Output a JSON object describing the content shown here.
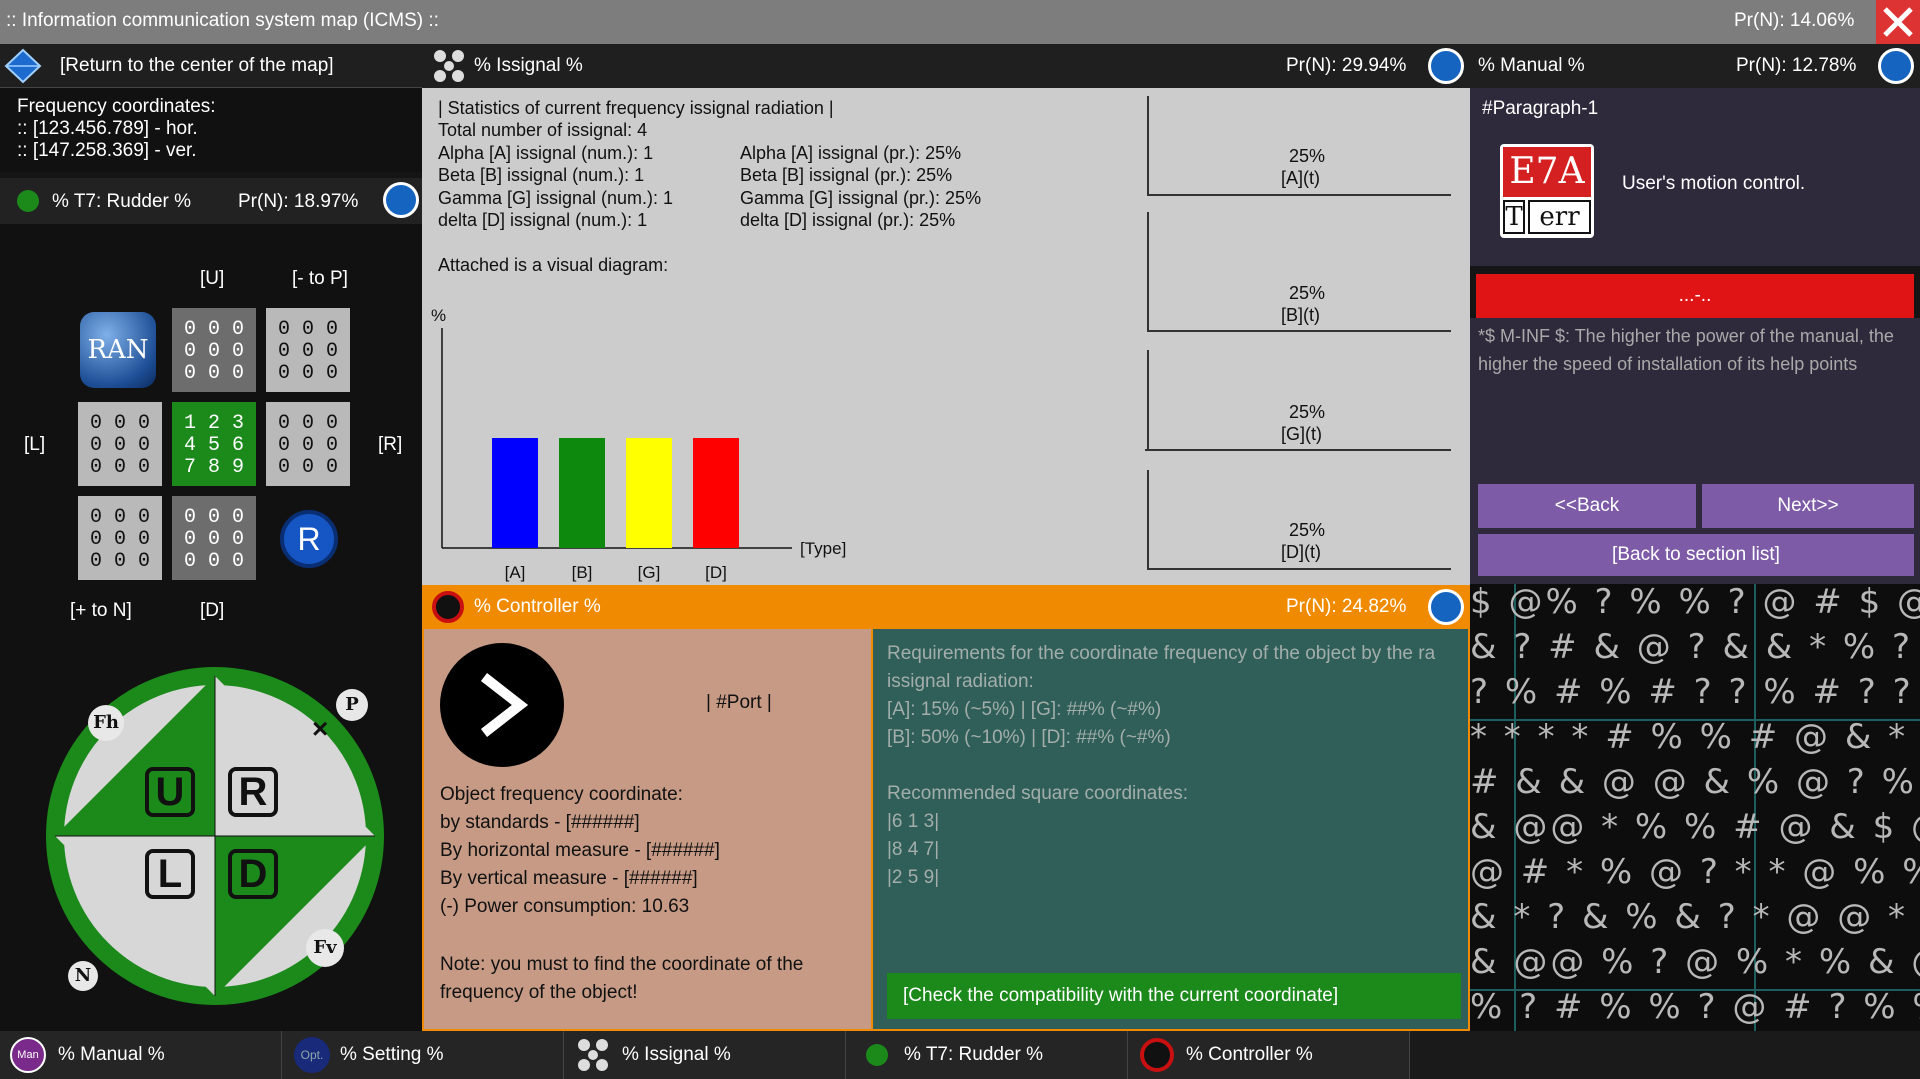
{
  "title": {
    "text": ":: Information communication system map (ICMS) ::",
    "pr": "Pr(N): 14.06%"
  },
  "map": {
    "return_label": "[Return to the center of the map]",
    "freq_title": "Frequency coordinates:",
    "hor": ":: [123.456.789] - hor.",
    "ver": ":: [147.258.369] - ver."
  },
  "rudder": {
    "title": "% T7: Rudder %",
    "pr": "Pr(N): 18.97%",
    "labels": {
      "u": "[U]",
      "to_p": "[- to P]",
      "l": "[L]",
      "r": "[R]",
      "to_n": "[+ to N]",
      "d": "[D]"
    },
    "ran": "RAN",
    "reg": "R",
    "cells": {
      "empty": "0 0 0\n0 0 0\n0 0 0",
      "center": "1 2 3\n4 5 6\n7 8 9"
    },
    "compass": {
      "u": "U",
      "r": "R",
      "l": "L",
      "d": "D",
      "fh": "Fh",
      "p": "P",
      "n": "N",
      "fv": "Fv",
      "x": "×"
    }
  },
  "issignal": {
    "title": "% Issignal %",
    "pr": "Pr(N): 29.94%",
    "heading": "| Statistics of current frequency issignal radiation |",
    "total": "Total number of issignal: 4",
    "rows": [
      {
        "name": "Alpha [A] issignal (num.): 1",
        "pr": "Alpha [A] issignal (pr.): 25%"
      },
      {
        "name": "Beta [B] issignal (num.): 1",
        "pr": "Beta [B] issignal (pr.): 25%"
      },
      {
        "name": "Gamma [G] issignal (num.): 1",
        "pr": "Gamma [G] issignal (pr.): 25%"
      },
      {
        "name": "delta [D] issignal (num.): 1",
        "pr": "delta [D] issignal (pr.): 25%"
      }
    ],
    "attached": "Attached is a visual diagram:"
  },
  "chart_data": {
    "type": "bar",
    "ylabel": "%",
    "xlabel": "[Type]",
    "categories": [
      "[A]",
      "[B]",
      "[G]",
      "[D]"
    ],
    "values": [
      25,
      25,
      25,
      25
    ],
    "colors": [
      "#0000ff",
      "#0d8a0d",
      "#ffff00",
      "#ff0000"
    ]
  },
  "mini": [
    {
      "pct": "25%",
      "label": "[A](t)"
    },
    {
      "pct": "25%",
      "label": "[B](t)"
    },
    {
      "pct": "25%",
      "label": "[G](t)"
    },
    {
      "pct": "25%",
      "label": "[D](t)"
    }
  ],
  "manual": {
    "title": "% Manual %",
    "pr": "Pr(N): 12.78%",
    "paragraph": "#Paragraph-1",
    "logo_top": "E7A",
    "logo_t": "T",
    "logo_err": "err",
    "caption": "User's motion control.",
    "red_bar": "...-..",
    "text": "*$ M-INF $: The higher the power of the manual, the higher the speed of installation of its help points",
    "back": "<<Back",
    "next": "Next>>",
    "section": "[Back to section list]"
  },
  "controller": {
    "title": "% Controller %",
    "pr": "Pr(N): 24.82%",
    "port": "| #Port |",
    "obj": [
      "Object frequency coordinate:",
      "by standards - [######]",
      "By horizontal measure - [######]",
      "By vertical measure - [######]",
      "(-) Power consumption: 10.63"
    ],
    "note": "Note: you must to find the coordinate of the frequency of the object!",
    "req": [
      "Requirements for the coordinate frequency of the object by the ra",
      "issignal radiation:",
      "[A]: 15% (~5%) | [G]: ##% (~#%)",
      "[B]: 50% (~10%) | [D]: ##% (~#%)"
    ],
    "rec_title": "Recommended square coordinates:",
    "rec": [
      "|6 1 3|",
      "|8 4 7|",
      "|2 5 9|"
    ],
    "check": "[Check the compatibility with the current coordinate]"
  },
  "symbols": [
    "$ @% ? % % ? @ # $ @@",
    "& ? # & @ ? & & * % ? %",
    "? % # % # ? ? % # ? ? %",
    "* * * * # % % # @ & * &",
    "# & & @ @ & % @ ? % % @",
    "& @@ * % % # @ & $ @ *",
    "@ # * % @ ? * * @ % %",
    "& * ? & % & ? * @ @ *",
    "& @@ % ? @ % * % & @",
    "% ? # % % ? @ # ? % %",
    "$ # % & @ % * * ? % &"
  ],
  "tabs": [
    {
      "icon": "Man",
      "label": "% Manual %"
    },
    {
      "icon": "Opt.",
      "label": "% Setting %"
    },
    {
      "icon": "",
      "label": "% Issignal %"
    },
    {
      "icon": "",
      "label": "% T7: Rudder %"
    },
    {
      "icon": "",
      "label": "% Controller %"
    }
  ],
  "colors": {
    "orange": "#f08a00",
    "green": "#1b8a1b",
    "red": "#e01414",
    "purple": "#7d5ba7",
    "teal": "#2f5f58",
    "salmon": "#c69a85"
  }
}
